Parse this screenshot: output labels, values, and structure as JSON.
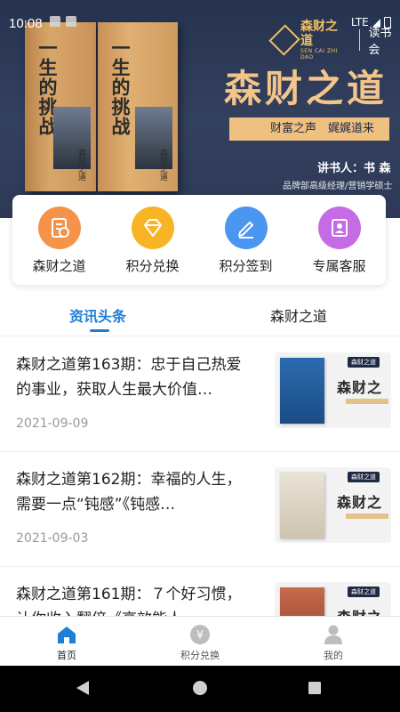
{
  "status_bar": {
    "time": "10:08",
    "network": "LTE"
  },
  "banner": {
    "book_title": "一生的挑战",
    "book_brand": "森财之道",
    "logo_text": "森财之道",
    "logo_sub": "SEN CAI ZHI DAO",
    "logo_tail": "读书会",
    "title": "森财之道",
    "slogan": "财富之声　娓娓道来",
    "speaker": "讲书人：书 森",
    "role": "品牌部高级经理/营销学硕士"
  },
  "quick_menu": {
    "items": [
      {
        "label": "森财之道",
        "icon": "ledger-icon",
        "color": "#f5934a"
      },
      {
        "label": "积分兑换",
        "icon": "diamond-icon",
        "color": "#f7b526"
      },
      {
        "label": "积分签到",
        "icon": "pen-icon",
        "color": "#4a96f0"
      },
      {
        "label": "专属客服",
        "icon": "user-card-icon",
        "color": "#c56be6"
      }
    ]
  },
  "tabs": {
    "items": [
      {
        "label": "资讯头条",
        "active": true
      },
      {
        "label": "森财之道",
        "active": false
      }
    ],
    "accent": "#1e7fd8"
  },
  "news": {
    "items": [
      {
        "title": "森财之道第163期：忠于自己热爱的事业，获取人生最大价值…",
        "date": "2021-09-09",
        "thumb_title": "森财之",
        "thumb_badge": "森财之道"
      },
      {
        "title": "森财之道第162期：幸福的人生，需要一点“钝感”《钝感…",
        "date": "2021-09-03",
        "thumb_title": "森财之",
        "thumb_badge": "森财之道"
      },
      {
        "title": "森财之道第161期：７个好习惯，让你收入翻倍《高效能人…",
        "date": "",
        "thumb_title": "森财之",
        "thumb_badge": "森财之道"
      }
    ]
  },
  "bottom_nav": {
    "items": [
      {
        "label": "首页",
        "icon": "home-icon",
        "active": true,
        "color": "#1e7fd8"
      },
      {
        "label": "积分兑换",
        "icon": "yuan-coin-icon",
        "active": false,
        "color": "#bdbdbd"
      },
      {
        "label": "我的",
        "icon": "person-icon",
        "active": false,
        "color": "#bdbdbd"
      }
    ]
  }
}
